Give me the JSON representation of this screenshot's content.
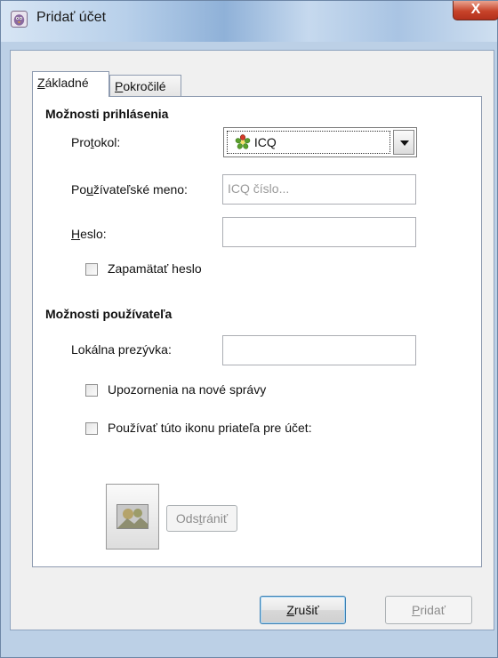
{
  "window": {
    "title": "Pridať účet",
    "close_glyph": "X"
  },
  "tabs": [
    {
      "pre": "",
      "accel": "Z",
      "post": "ákladné"
    },
    {
      "pre": "",
      "accel": "P",
      "post": "okročilé"
    }
  ],
  "login_options": {
    "title": "Možnosti prihlásenia",
    "protocol": {
      "pre": "Pro",
      "accel": "t",
      "post": "okol:",
      "value": "ICQ"
    },
    "username": {
      "pre": "Po",
      "accel": "u",
      "post": "žívateľské meno:",
      "placeholder": "ICQ číslo..."
    },
    "password": {
      "pre": "",
      "accel": "H",
      "post": "eslo:"
    },
    "remember_password": "Zapamätať heslo"
  },
  "user_options": {
    "title": "Možnosti používateľa",
    "local_alias": "Lokálna prezývka:",
    "new_mail_notify": "Upozornenia na nové správy",
    "use_buddy_icon": "Používať túto ikonu priateľa pre účet:",
    "remove": {
      "pre": "Ods",
      "accel": "t",
      "post": "rániť"
    }
  },
  "buttons": {
    "cancel": {
      "pre": "",
      "accel": "Z",
      "post": "rušiť"
    },
    "add": {
      "pre": "",
      "accel": "P",
      "post": "ridať"
    }
  },
  "colors": {
    "accent_blue": "#3c7fb1",
    "icq_green": "#5aa02c",
    "close_red": "#c7432a"
  },
  "icons": {
    "app": "pidgin-icon",
    "protocol": "icq-flower-icon",
    "buddy": "buddy-image-icon"
  }
}
